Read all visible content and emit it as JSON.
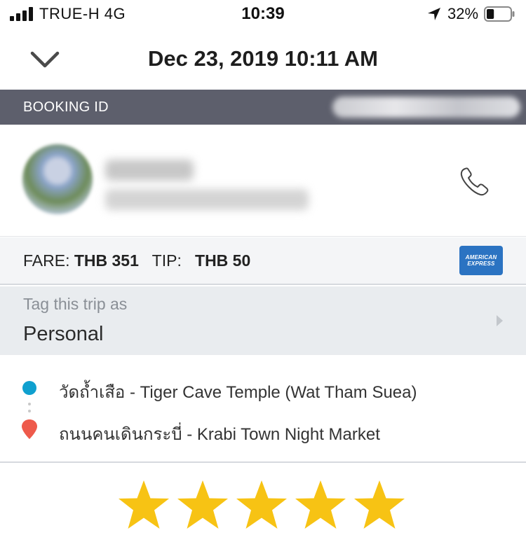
{
  "status_bar": {
    "carrier": "TRUE-H  4G",
    "time": "10:39",
    "battery_percent": "32%",
    "battery_level": 0.32,
    "signal_icon": "signal-bars-icon",
    "location_icon": "location-arrow-icon",
    "battery_icon": "battery-icon"
  },
  "header": {
    "title": "Dec 23, 2019 10:11 AM",
    "back_icon": "chevron-down-icon"
  },
  "booking": {
    "label": "BOOKING ID"
  },
  "driver": {
    "call_icon": "phone-icon"
  },
  "fare": {
    "fare_label": "FARE:",
    "fare_value": "THB 351",
    "tip_label": "TIP:",
    "tip_value": "THB 50",
    "card_brand_line1": "AMERICAN",
    "card_brand_line2": "EXPRESS"
  },
  "tag": {
    "label": "Tag this trip as",
    "value": "Personal",
    "arrow_icon": "chevron-right-icon"
  },
  "route": {
    "pickup": "วัดถ้ำเสือ - Tiger Cave Temple (Wat Tham Suea)",
    "dropoff": "ถนนคนเดินกระบี่ - Krabi Town Night Market",
    "pickup_icon": "pickup-dot-icon",
    "dropoff_icon": "dropoff-pin-icon"
  },
  "rating": {
    "stars": 5,
    "max_stars": 5,
    "star_color": "#f7c314"
  },
  "colors": {
    "booking_bar": "#5d5f6c",
    "pickup_dot": "#0fa0cf",
    "dropoff_pin": "#ee5a4b",
    "amex_blue": "#2b73c2"
  }
}
